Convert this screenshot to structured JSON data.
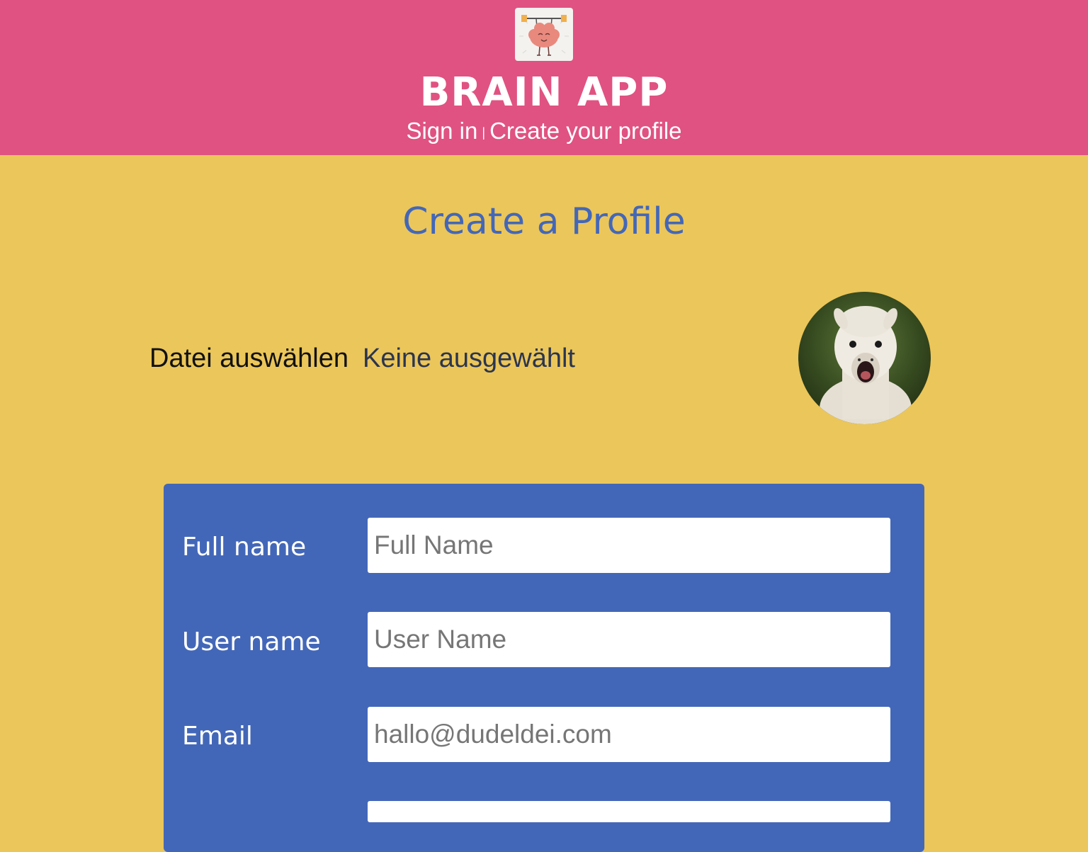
{
  "header": {
    "app_title": "BRAIN APP",
    "nav": {
      "sign_in": "Sign in",
      "separator": "|",
      "create_profile": "Create your profile"
    },
    "colors": {
      "background": "#e05281",
      "text": "#ffffff"
    }
  },
  "main": {
    "page_title": "Create a Profile",
    "file_picker": {
      "button_label": "Datei auswählen",
      "status": "Keine ausgewählt"
    },
    "form": {
      "fields": [
        {
          "label": "Full name",
          "placeholder": "Full Name"
        },
        {
          "label": "User name",
          "placeholder": "User Name"
        },
        {
          "label": "Email",
          "placeholder": "hallo@dudeldei.com"
        }
      ]
    }
  },
  "colors": {
    "page_background": "#ebc65a",
    "accent_blue": "#4367b8",
    "header_pink": "#e05281"
  },
  "icons": {
    "logo": "brain-lifting-weights-icon",
    "avatar": "alpaca-avatar"
  }
}
